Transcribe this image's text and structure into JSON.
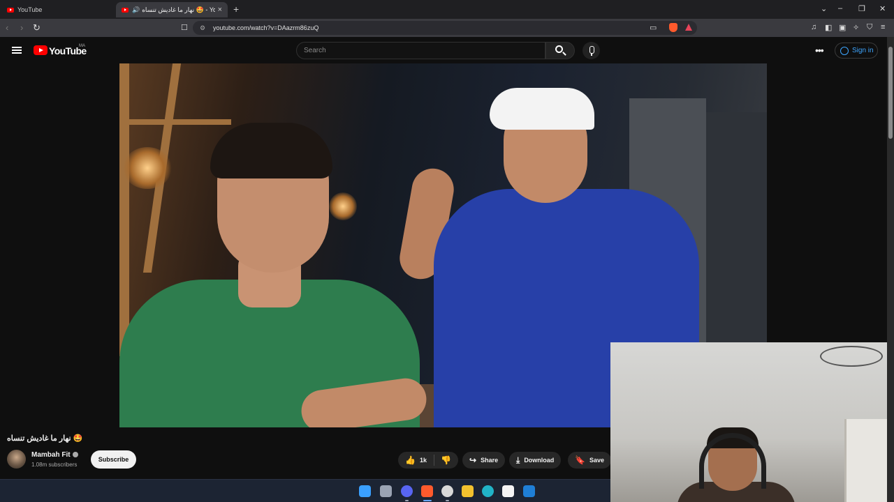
{
  "browser": {
    "tabs": [
      {
        "title": "YouTube",
        "active": false
      },
      {
        "title": "نهار ما غاديش تنساه 🤩 - YouTube",
        "active": true
      }
    ],
    "new_tab": "+",
    "url": "youtube.com/watch?v=DAazrm86zuQ",
    "window_controls": {
      "dropdown": "⌄",
      "minimize": "–",
      "restore": "❐",
      "close": "✕"
    }
  },
  "youtube": {
    "logo_text": "YouTube",
    "region": "MA",
    "search": {
      "placeholder": "Search"
    },
    "more": "•••",
    "sign_in": "Sign in"
  },
  "video": {
    "title": "نهار ما غاديش تنساه 🤩",
    "channel": "Mambah Fit",
    "subscribers": "1.08m subscribers",
    "subscribe_label": "Subscribe",
    "likes": "1k",
    "share_label": "Share",
    "download_label": "Download",
    "save_label": "Save"
  },
  "icons": {
    "back": "‹",
    "forward": "›",
    "reload": "↻",
    "bookmark": "🔖",
    "site_info": "⚙",
    "like": "👍",
    "dislike": "👎",
    "share": "↪",
    "download": "⤓",
    "save": "🔖"
  },
  "taskbar": {
    "apps": [
      {
        "name": "start",
        "color": "#3aa0ff"
      },
      {
        "name": "task-view",
        "color": "#9aa3b3"
      },
      {
        "name": "discord",
        "color": "#5865f2"
      },
      {
        "name": "brave",
        "color": "#ff5a2c"
      },
      {
        "name": "chatgpt",
        "color": "#d8d8d8"
      },
      {
        "name": "file-explorer",
        "color": "#f2c12e"
      },
      {
        "name": "edge",
        "color": "#21b3c7"
      },
      {
        "name": "store",
        "color": "#f4f4f4"
      },
      {
        "name": "outlook",
        "color": "#1f7fd6"
      }
    ]
  }
}
